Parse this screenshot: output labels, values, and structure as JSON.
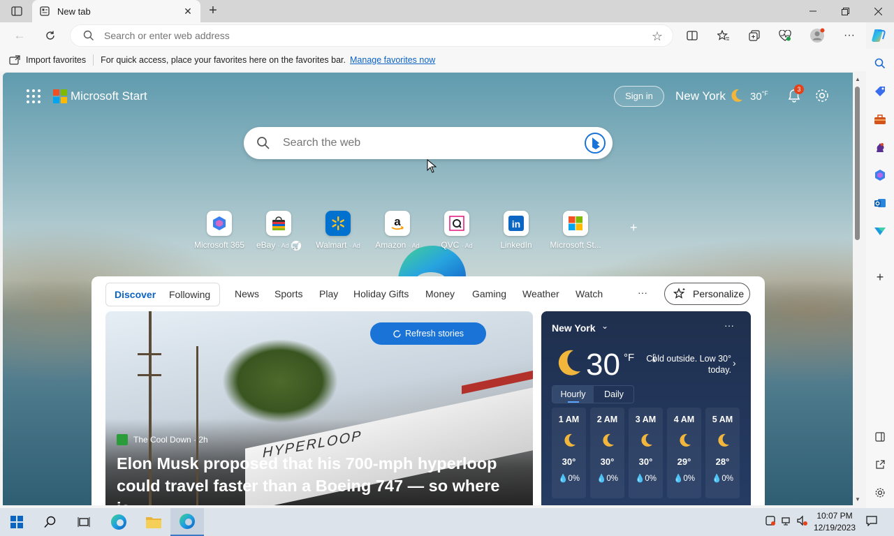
{
  "browser": {
    "tab_title": "New tab",
    "address_placeholder": "Search or enter web address"
  },
  "favorites_bar": {
    "import_label": "Import favorites",
    "message": "For quick access, place your favorites here on the favorites bar.",
    "manage_link": "Manage favorites now"
  },
  "header": {
    "brand": "Microsoft Start",
    "sign_in": "Sign in",
    "city": "New York",
    "temp": "30",
    "temp_unit": "°F",
    "notification_count": "3"
  },
  "web_search": {
    "placeholder": "Search the web"
  },
  "tiles": [
    {
      "label": "Microsoft 365",
      "ad": ""
    },
    {
      "label": "eBay",
      "ad": "· Ad"
    },
    {
      "label": "Walmart",
      "ad": "· Ad"
    },
    {
      "label": "Amazon",
      "ad": "· Ad"
    },
    {
      "label": "QVC",
      "ad": "· Ad"
    },
    {
      "label": "LinkedIn",
      "ad": ""
    },
    {
      "label": "Microsoft St...",
      "ad": ""
    }
  ],
  "feed_nav": {
    "discover": "Discover",
    "following": "Following",
    "items": [
      "News",
      "Sports",
      "Play",
      "Holiday Gifts",
      "Money",
      "Gaming",
      "Weather",
      "Watch"
    ],
    "more": "···",
    "personalize": "Personalize"
  },
  "hero": {
    "refresh": "Refresh stories",
    "source": "The Cool Down · 2h",
    "headline": "Elon Musk proposed that his 700-mph hyperloop could travel faster than a Boeing 747 — so where is...",
    "image_text": "HYPERLOOP"
  },
  "weather": {
    "city": "New York",
    "more": "···",
    "temp": "30",
    "unit": "°F",
    "description": "Cold outside. Low 30° today.",
    "tab_hourly": "Hourly",
    "tab_daily": "Daily",
    "hourly": [
      {
        "time": "1 AM",
        "temp": "30°",
        "precip": "0%"
      },
      {
        "time": "2 AM",
        "temp": "30°",
        "precip": "0%"
      },
      {
        "time": "3 AM",
        "temp": "30°",
        "precip": "0%"
      },
      {
        "time": "4 AM",
        "temp": "29°",
        "precip": "0%"
      },
      {
        "time": "5 AM",
        "temp": "28°",
        "precip": "0%"
      }
    ]
  },
  "taskbar": {
    "time": "10:07 PM",
    "date": "12/19/2023"
  },
  "colors": {
    "accent": "#1a73d6",
    "link": "#0b62c4",
    "weather_bg": "#22365a",
    "notification_badge": "#e3421b"
  }
}
